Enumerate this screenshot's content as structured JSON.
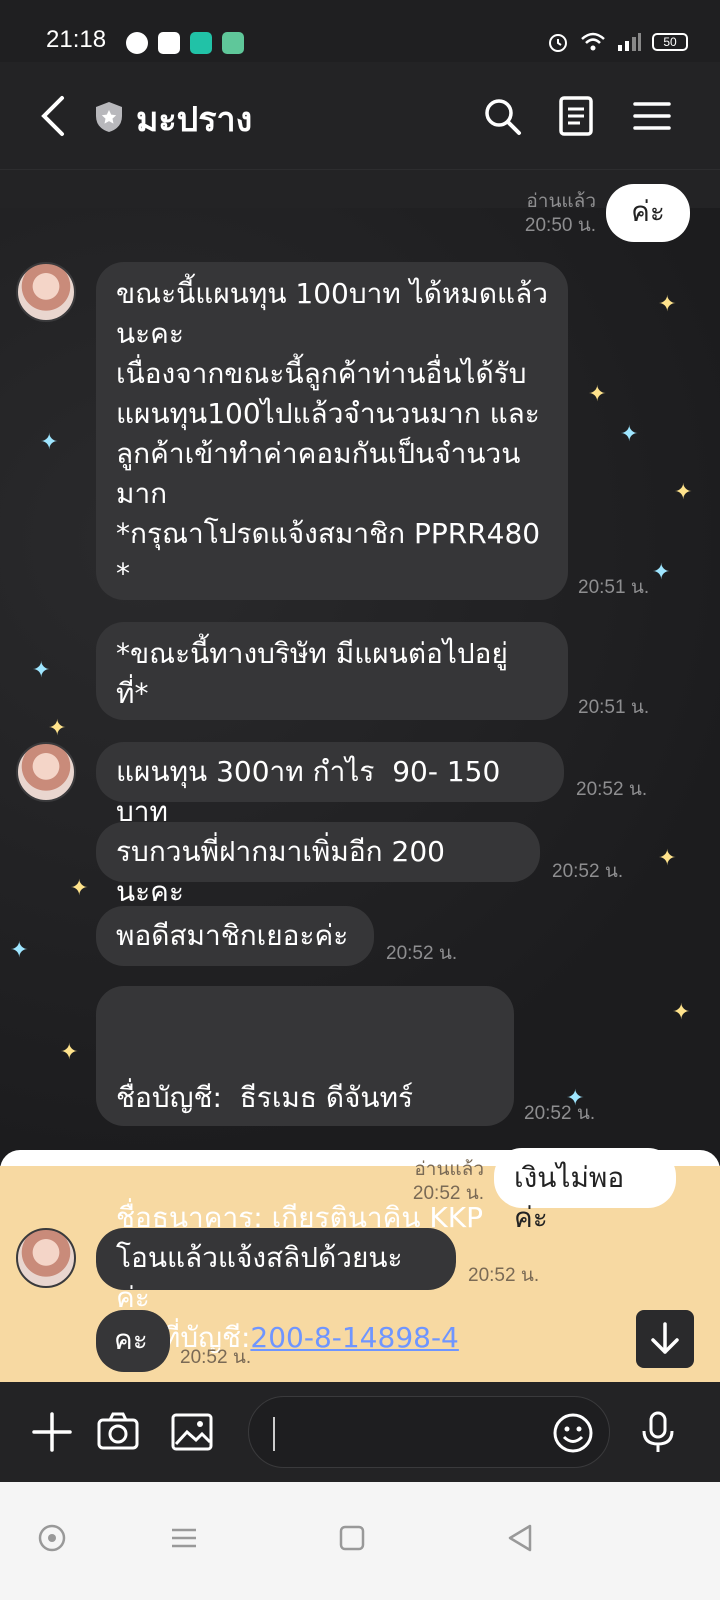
{
  "status_bar": {
    "time": "21:18",
    "battery": "50"
  },
  "header": {
    "title": "มะปราง"
  },
  "colors": {
    "bubble_other": "#363638",
    "bubble_me": "#ffffff",
    "link": "#6f95ff",
    "sand": "#f7d9a2"
  },
  "messages": [
    {
      "from": "me",
      "text": "ค่ะ",
      "read": "อ่านแล้ว",
      "time": "20:50 น."
    },
    {
      "from": "other",
      "text": "ขณะนี้แผนทุน 100บาท ได้หมดแล้ว\nนะคะ\nเนื่องจากขณะนี้ลูกค้าท่านอื่นได้รับ\nแผนทุน100ไปแล้วจำนวนมาก และ\nลูกค้าเข้าทำค่าคอมกันเป็นจำนวน\nมาก\n*กรุณาโปรดแจ้งสมาชิก PPRR480\n*",
      "time": "20:51 น."
    },
    {
      "from": "other",
      "text": "*ขณะนี้ทางบริษัท มีแผนต่อไปอยู่\nที่*",
      "time": "20:51 น."
    },
    {
      "from": "other",
      "text": "แผนทุน 300าท กำไร  90- 150 บาท",
      "time": "20:52 น."
    },
    {
      "from": "other",
      "text": "รบกวนพี่ฝากมาเพิ่มอีก 200 นะคะ",
      "time": "20:52 น."
    },
    {
      "from": "other",
      "text": "พอดีสมาชิกเยอะค่ะ",
      "time": "20:52 น."
    },
    {
      "from": "other",
      "text_lines": [
        "ชื่อบัญชี:  ธีรเมธ ดีจันทร์",
        "ชื่อธนาคาร: เกียรตินาคิน KKP"
      ],
      "account_label": "เลขที่บัญชี:",
      "account_number": "200-8-14898-4",
      "time": "20:52 น."
    },
    {
      "from": "me",
      "text": "เงินไม่พอค่ะ",
      "read": "อ่านแล้ว",
      "time": "20:52 น."
    },
    {
      "from": "other",
      "text": "โอนแล้วแจ้งสลิปด้วยนะค่ะ",
      "time": "20:52 น."
    },
    {
      "from": "other",
      "text": "คะ",
      "time": "20:52 น."
    }
  ],
  "icons": [
    "back-icon",
    "shield-icon",
    "search-icon",
    "notes-icon",
    "menu-icon",
    "plus-icon",
    "camera-icon",
    "image-icon",
    "emoji-icon",
    "mic-icon",
    "arrow-down-icon"
  ]
}
